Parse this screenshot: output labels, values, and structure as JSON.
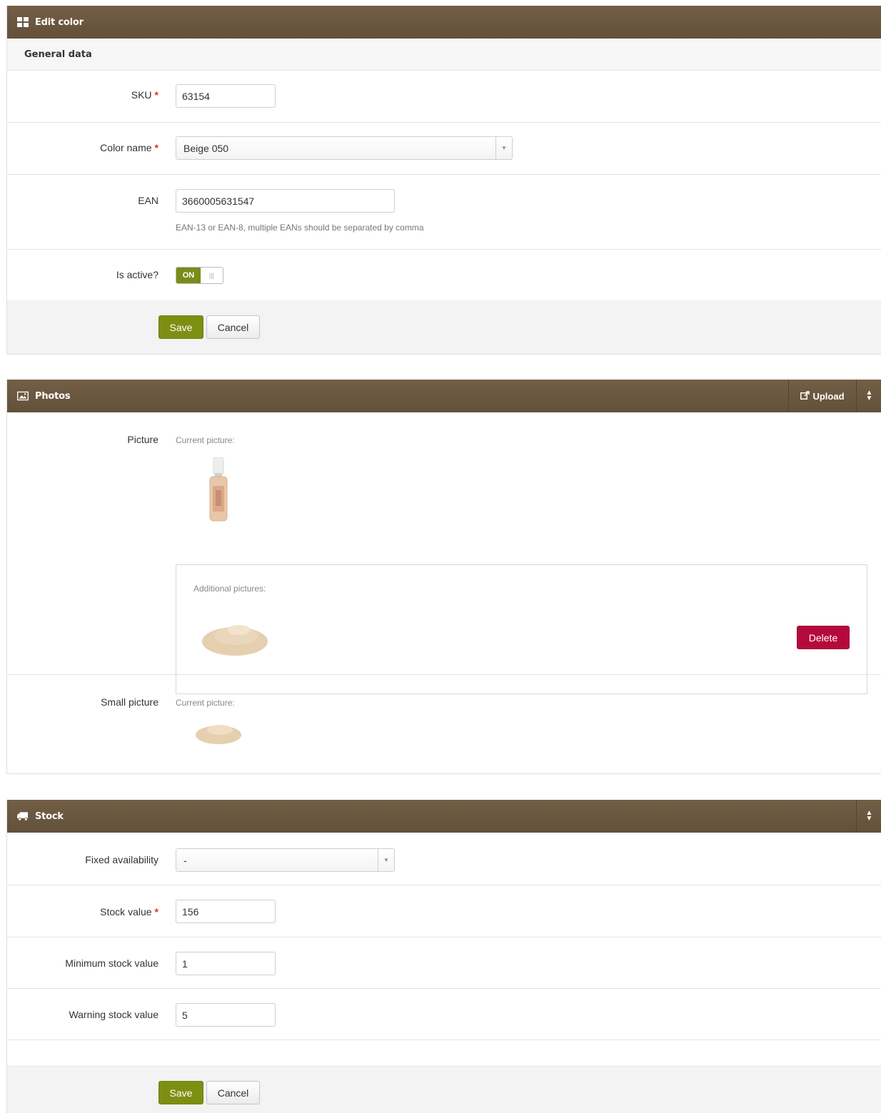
{
  "edit_color": {
    "title": "Edit color",
    "icon": "grid-icon",
    "sub_header": "General data",
    "sku": {
      "label": "SKU",
      "required": "*",
      "value": "63154"
    },
    "color_name": {
      "label": "Color name",
      "required": "*",
      "value": "Beige 050"
    },
    "ean": {
      "label": "EAN",
      "value": "3660005631547",
      "hint": "EAN-13 or EAN-8, multiple EANs should be separated by comma"
    },
    "is_active": {
      "label": "Is active?",
      "state": "ON"
    },
    "save_label": "Save",
    "cancel_label": "Cancel"
  },
  "photos": {
    "title": "Photos",
    "icon": "image-icon",
    "upload_label": "Upload",
    "picture_label": "Picture",
    "current_picture_label": "Current picture:",
    "additional_pictures_label": "Additional pictures:",
    "delete_label": "Delete",
    "small_picture_label": "Small picture",
    "small_current_picture_label": "Current picture:"
  },
  "stock": {
    "title": "Stock",
    "icon": "truck-icon",
    "fixed_availability": {
      "label": "Fixed availability",
      "value": "-"
    },
    "stock_value": {
      "label": "Stock value",
      "required": "*",
      "value": "156"
    },
    "minimum_stock_value": {
      "label": "Minimum stock value",
      "value": "1"
    },
    "warning_stock_value": {
      "label": "Warning stock value",
      "value": "5"
    },
    "save_label": "Save",
    "cancel_label": "Cancel"
  },
  "colors": {
    "header_brown": "#6e5a42",
    "save_green": "#7d8f13",
    "delete_red": "#b5093b",
    "required_red": "#d9302f"
  }
}
